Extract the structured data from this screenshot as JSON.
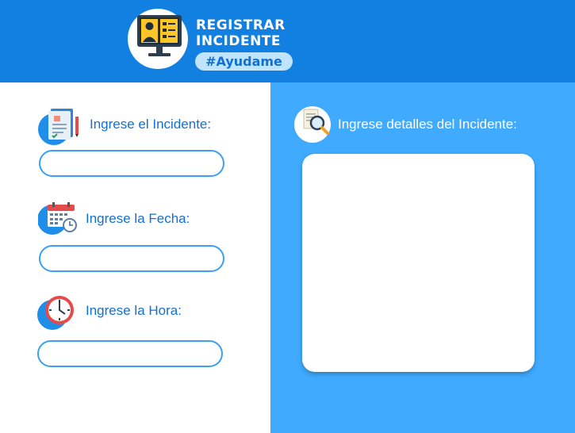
{
  "header": {
    "title_line1": "REGISTRAR",
    "title_line2": "INCIDENTE",
    "hashtag": "#Ayudame",
    "logo_icon": "computer-user-icon",
    "background_color": "#1180e0"
  },
  "form": {
    "incidente": {
      "label": "Ingrese el Incidente:",
      "icon": "document-icon",
      "value": "",
      "placeholder": ""
    },
    "fecha": {
      "label": "Ingrese la Fecha:",
      "icon": "calendar-icon",
      "value": "",
      "placeholder": ""
    },
    "hora": {
      "label": "Ingrese la Hora:",
      "icon": "clock-icon",
      "value": "",
      "placeholder": ""
    }
  },
  "details": {
    "label": "Ingrese detalles del Incidente:",
    "icon": "magnifier-document-icon",
    "value": "",
    "panel_color": "#40aaff"
  },
  "colors": {
    "accent": "#1270d0",
    "input_border": "#3aa0f2"
  }
}
